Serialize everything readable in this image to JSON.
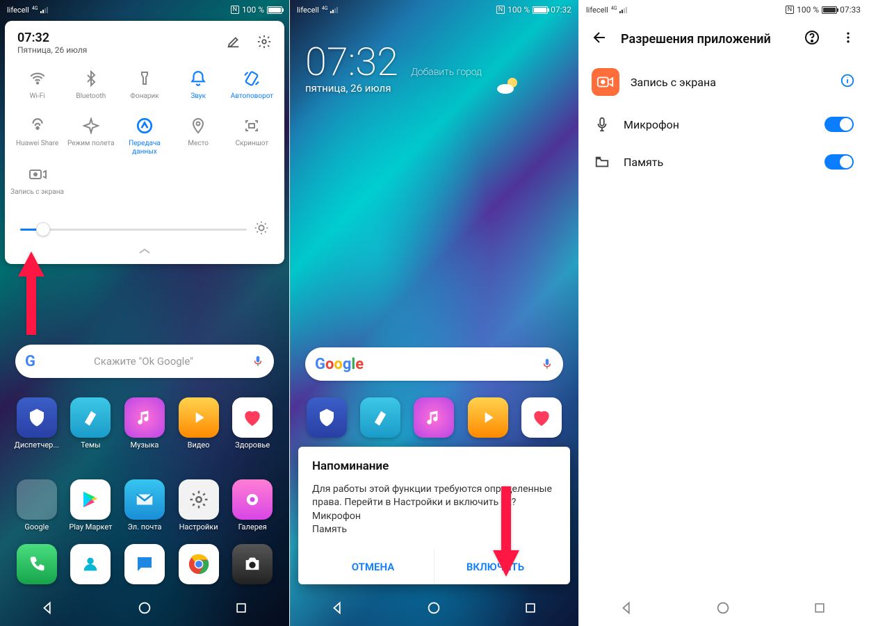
{
  "phone1": {
    "status": {
      "carrier": "lifecell",
      "net": "4G",
      "nfc": "N",
      "battery": "100 %"
    },
    "qs": {
      "time": "07:32",
      "date": "Пятница, 26 июля",
      "tiles": [
        {
          "id": "wifi",
          "label": "Wi-Fi",
          "active": false
        },
        {
          "id": "bt",
          "label": "Bluetooth",
          "active": false
        },
        {
          "id": "torch",
          "label": "Фонарик",
          "active": false
        },
        {
          "id": "sound",
          "label": "Звук",
          "active": true
        },
        {
          "id": "rotate",
          "label": "Автоповорот",
          "active": true
        },
        {
          "id": "hwshare",
          "label": "Huawei Share",
          "active": false
        },
        {
          "id": "airplane",
          "label": "Режим полета",
          "active": false
        },
        {
          "id": "data",
          "label": "Передача данных",
          "active": true
        },
        {
          "id": "location",
          "label": "Место",
          "active": false
        },
        {
          "id": "screenshot",
          "label": "Скриншот",
          "active": false
        },
        {
          "id": "screenrec",
          "label": "Запись с экрана",
          "active": false
        }
      ]
    },
    "search_hint": "Скажите \"Ok Google\"",
    "apps_r1": [
      "Диспетчер...",
      "Темы",
      "Музыка",
      "Видео",
      "Здоровье"
    ],
    "apps_r2": [
      "Google",
      "Play Маркет",
      "Эл. почта",
      "Настройки",
      "Галерея"
    ]
  },
  "phone2": {
    "status": {
      "carrier": "lifecell",
      "net": "4G",
      "nfc": "N",
      "battery": "100 %",
      "time": "07:32"
    },
    "clock": {
      "time": "07:32",
      "city": "Добавить город",
      "date": "пятница, 26 июля"
    },
    "dialog": {
      "title": "Напоминание",
      "body": "Для работы этой функции требуются определенные права. Перейти в Настройки и включить их?\nМикрофон\nПамять",
      "cancel": "ОТМЕНА",
      "ok": "ВКЛЮЧИТЬ"
    }
  },
  "phone3": {
    "status": {
      "carrier": "lifecell",
      "net": "4G",
      "nfc": "N",
      "battery": "100 %",
      "time": "07:33"
    },
    "title": "Разрешения приложений",
    "app_name": "Запись с экрана",
    "perms": [
      {
        "id": "mic",
        "label": "Микрофон",
        "on": true
      },
      {
        "id": "storage",
        "label": "Память",
        "on": true
      }
    ]
  }
}
